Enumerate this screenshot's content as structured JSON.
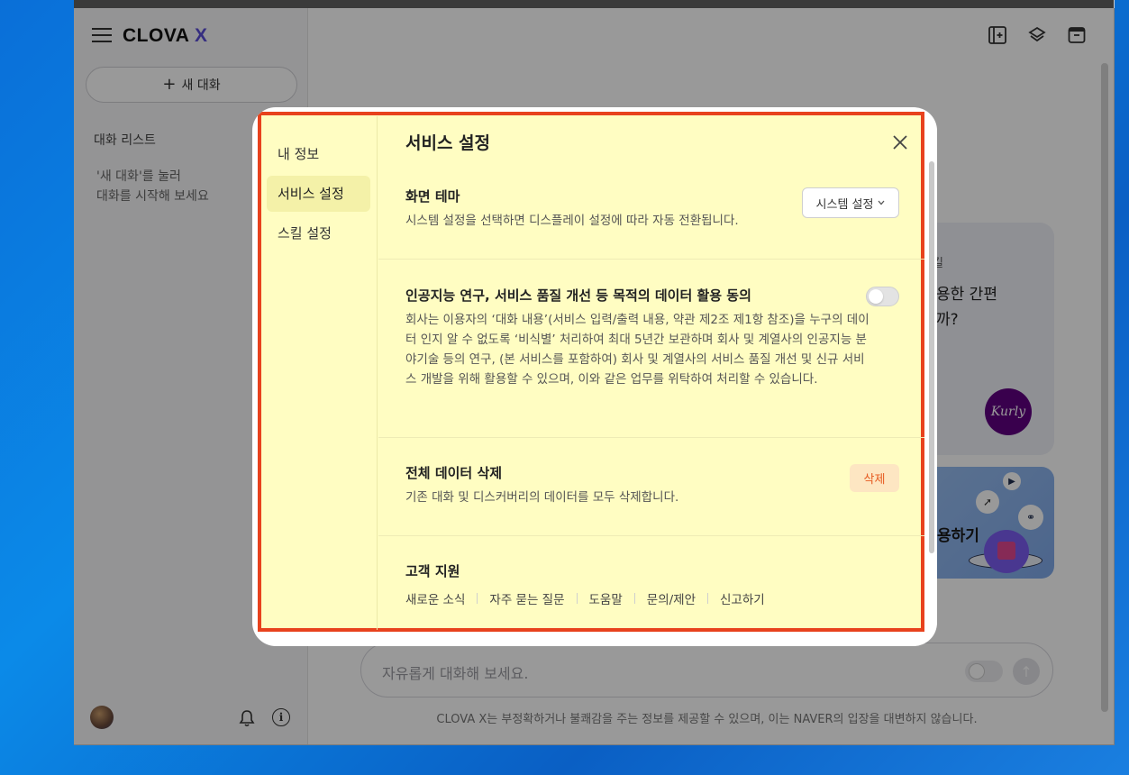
{
  "app": {
    "logo_text": "CLOVA",
    "logo_x": "X",
    "new_chat_label": "새 대화",
    "chat_list_title": "대화 리스트",
    "empty_hint": "'새 대화'를 눌러\n대화를 시작해 보세요",
    "input_placeholder": "자유롭게 대화해 보세요.",
    "disclaimer": "CLOVA X는 부정확하거나 불쾌감을 주는 정보를 제공할 수 있으며, 이는 NAVER의 입장을 대변하지 않습니다."
  },
  "cards": {
    "card1_eyebrow": "킬",
    "card1_title": "용한 간편\n까?",
    "card1_badge": "Kurly",
    "card2_title": "용하기"
  },
  "modal": {
    "nav": [
      "내 정보",
      "서비스 설정",
      "스킬 설정"
    ],
    "title": "서비스 설정",
    "theme": {
      "title": "화면 테마",
      "desc": "시스템 설정을 선택하면 디스플레이 설정에 따라 자동 전환됩니다.",
      "select_value": "시스템 설정"
    },
    "consent": {
      "title": "인공지능 연구, 서비스 품질 개선 등 목적의 데이터 활용 동의",
      "desc": "회사는 이용자의 ‘대화 내용’(서비스 입력/출력 내용, 약관 제2조 제1항 참조)을 누구의 데이터 인지 알 수 없도록 ‘비식별’ 처리하여 최대 5년간 보관하며 회사 및 계열사의 인공지능 분야기술 등의 연구, (본 서비스를 포함하여) 회사 및 계열사의 서비스 품질 개선 및 신규 서비스 개발을 위해 활용할 수 있으며, 이와 같은 업무를 위탁하여 처리할 수 있습니다.",
      "enabled": false
    },
    "delete": {
      "title": "전체 데이터 삭제",
      "desc": "기존 대화 및 디스커버리의 데이터를 모두 삭제합니다.",
      "button": "삭제"
    },
    "support": {
      "title": "고객 지원",
      "links": [
        "새로운 소식",
        "자주 묻는 질문",
        "도움말",
        "문의/제안",
        "신고하기"
      ]
    }
  },
  "colors": {
    "highlight_border": "#e8421d",
    "highlight_fill": "#fffdc2",
    "delete_text": "#e65a20",
    "brand_x": "#5b4dd6"
  }
}
